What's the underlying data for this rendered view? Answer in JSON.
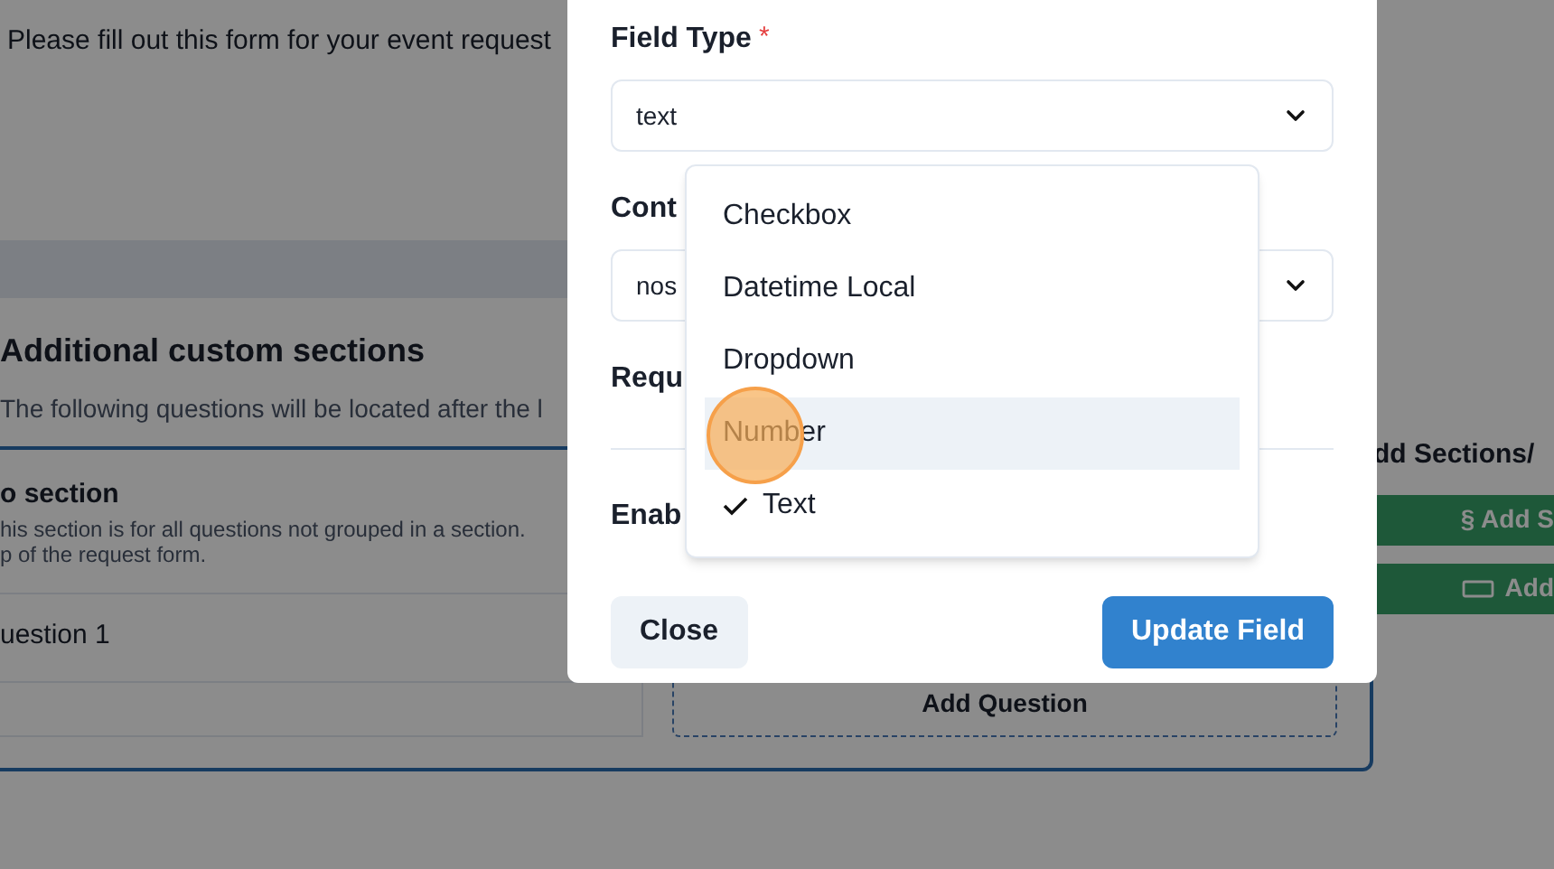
{
  "page": {
    "intro": "Please fill out this form for your event request",
    "section_heading": "Additional custom sections",
    "section_subtitle": "The following questions will be located after the l",
    "no_section": {
      "title": "o section",
      "description": [
        "his section is for all questions not grouped in a section.",
        "p of the request form."
      ],
      "questions": [
        "uestion 1"
      ],
      "add_question": "Add Question"
    },
    "side_panel": {
      "title": "dd Sections/",
      "buttons": [
        {
          "kind": "section",
          "label": "§ Add S"
        },
        {
          "kind": "question",
          "label": "Add"
        }
      ]
    }
  },
  "modal": {
    "fields": [
      {
        "kind": "select",
        "label": "Field Type",
        "required_mark": "*",
        "value": "text"
      },
      {
        "kind": "select",
        "label": "Cont",
        "value": "nos"
      },
      {
        "kind": "toggle",
        "label": "Requ"
      },
      {
        "kind": "toggle",
        "label": "Enab"
      }
    ],
    "dropdown": [
      {
        "label": "Checkbox",
        "selected": false,
        "highlighted": false
      },
      {
        "label": "Datetime Local",
        "selected": false,
        "highlighted": false
      },
      {
        "label": "Dropdown",
        "selected": false,
        "highlighted": false
      },
      {
        "label": "Number",
        "selected": false,
        "highlighted": true
      },
      {
        "label": "Text",
        "selected": true,
        "highlighted": false
      }
    ],
    "buttons": [
      {
        "kind": "secondary",
        "label": "Close"
      },
      {
        "kind": "primary",
        "label": "Update Field"
      }
    ]
  }
}
